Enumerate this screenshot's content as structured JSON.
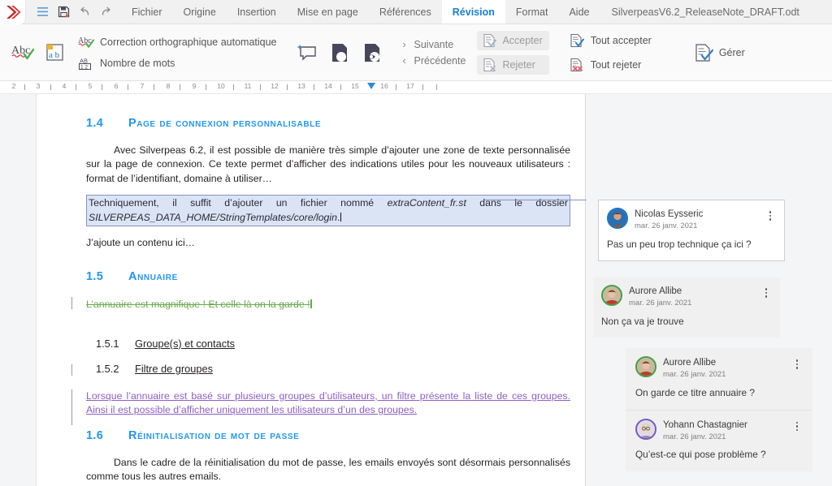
{
  "menubar": {
    "logo_icon": "silverpeas-chevron-logo",
    "icons": [
      {
        "name": "hamburger-menu-icon",
        "glyph": "hamburger"
      },
      {
        "name": "save-icon",
        "glyph": "floppy"
      },
      {
        "name": "undo-icon",
        "glyph": "undo"
      },
      {
        "name": "redo-icon",
        "glyph": "redo"
      }
    ],
    "items": [
      {
        "label": "Fichier",
        "active": false
      },
      {
        "label": "Origine",
        "active": false
      },
      {
        "label": "Insertion",
        "active": false
      },
      {
        "label": "Mise en page",
        "active": false
      },
      {
        "label": "Références",
        "active": false
      },
      {
        "label": "Révision",
        "active": true
      },
      {
        "label": "Format",
        "active": false
      },
      {
        "label": "Aide",
        "active": false
      }
    ],
    "document_title": "SilverpeasV6.2_ReleaseNote_DRAFT.odt"
  },
  "toolbar": {
    "spellcheck_icon": "spellcheck-abc-icon",
    "language_icon": "language-ab-icon",
    "autocorrect_label": "Correction orthographique automatique",
    "autocorrect_icon": "autocorrect-abc-check-icon",
    "wordcount_label": "Nombre de mots",
    "wordcount_icon": "word-count-icon",
    "add_comment_icon": "add-comment-icon",
    "track_changes_icon": "track-changes-icon",
    "display_changes_icon": "display-for-review-icon",
    "next_label": "Suivante",
    "prev_label": "Précédente",
    "accept_label": "Accepter",
    "reject_label": "Rejeter",
    "accept_all_label": "Tout accepter",
    "reject_all_label": "Tout rejeter",
    "manage_label": "Gérer",
    "accept_icon": "accept-change-icon",
    "reject_icon": "reject-change-icon",
    "accept_all_icon": "accept-all-changes-icon",
    "reject_all_icon": "reject-all-changes-icon",
    "manage_icon": "manage-changes-icon"
  },
  "ruler": {
    "ticks": [
      "2",
      "3",
      "4",
      "5",
      "6",
      "7",
      "8",
      "9",
      "10",
      "11",
      "12",
      "13",
      "14",
      "15",
      "16",
      "17"
    ],
    "indent_marker_position": "15.5"
  },
  "document": {
    "sections": {
      "s14_num": "1.4",
      "s14_title": "Page de connexion personnalisable",
      "s14_para": "Avec Silverpeas 6.2, il est possible de manière très simple d’ajouter une zone de texte personnalisée sur la page de connexion. Ce texte permet d’afficher des indications utiles pour les nouveaux utilisateurs : format de l’identifiant, domaine à utiliser…",
      "anchored_pre": "Techniquement, il suffit d’ajouter un fichier nommé ",
      "anchored_em": "extraContent_fr.st",
      "anchored_mid": " dans le dossier ",
      "anchored_em2": "SILVERPEAS_DATA_HOME/StringTemplates/core/login",
      "anchored_post": ".",
      "added_para": "J’ajoute un contenu ici…",
      "s15_num": "1.5",
      "s15_title": "Annuaire",
      "deleted_text": "L’annuaire est magnifique ! Et celle là on la garde !",
      "s151_num": "1.5.1",
      "s151_title": "Groupe(s) et contacts",
      "s152_num": "1.5.2",
      "s152_title": "Filtre de groupes",
      "inserted_para": "Lorsque l’annuaire est basé sur plusieurs groupes d’utilisateurs, un filtre présente la liste de ces groupes. Ainsi il est possible d’afficher uniquement les utilisateurs d’un des groupes.",
      "s16_num": "1.6",
      "s16_title": "Réinitialisation de mot de passe",
      "s16_para": "Dans le cadre de la réinitialisation du mot de passe, les emails envoyés sont désormais personnalisés comme tous les autres emails."
    }
  },
  "comments": {
    "cards": [
      {
        "style": "active",
        "items": [
          {
            "author": "Nicolas Eysseric",
            "date": "mar. 26 janv. 2021",
            "text": "Pas un peu trop technique ça ici ?",
            "avatar_ring": "#1a73c8"
          }
        ]
      },
      {
        "style": "flat",
        "items": [
          {
            "author": "Aurore Allibe",
            "date": "mar. 26 janv. 2021",
            "text": "Non ça va je trouve",
            "avatar_ring": "#43a047"
          }
        ]
      },
      {
        "style": "group",
        "items": [
          {
            "author": "Aurore Allibe",
            "date": "mar. 26 janv. 2021",
            "text": "On garde ce titre annuaire ?",
            "avatar_ring": "#43a047"
          },
          {
            "author": "Yohann Chastagnier",
            "date": "mar. 26 janv. 2021",
            "text": "Qu’est-ce qui pose problème ?",
            "avatar_ring": "#7e57c2"
          }
        ]
      }
    ],
    "menu_icon": "kebab-menu-icon"
  },
  "colors": {
    "accent_blue": "#2196f3",
    "active_tab": "#1b7fd4",
    "deleted_green": "#6aa84f",
    "inserted_purple": "#8e5fc4",
    "anchor_highlight": "#dbe4f5",
    "anchor_border": "#8a8fc4"
  }
}
